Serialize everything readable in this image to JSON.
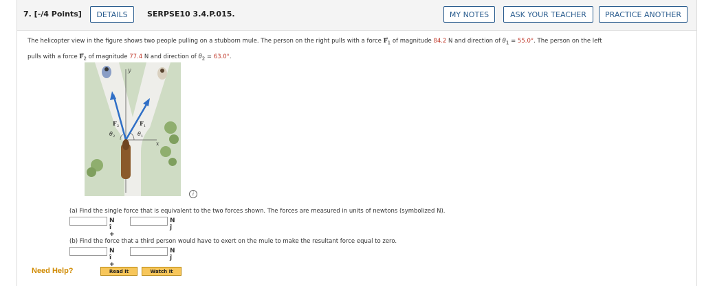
{
  "header": {
    "question_label": "7.  [-/4 Points]",
    "details_label": "DETAILS",
    "problem_code": "SERPSE10 3.4.P.015.",
    "my_notes_label": "MY NOTES",
    "ask_teacher_label": "ASK YOUR TEACHER",
    "practice_label": "PRACTICE ANOTHER"
  },
  "problem": {
    "text1": "The helicopter view in the figure shows two people pulling on a stubborn mule. The person on the right pulls with a force ",
    "f1": "F",
    "f1_sub": "1",
    "text2": " of magnitude ",
    "f1_mag": "84.2",
    "text3": " N and direction of ",
    "theta1": "θ",
    "theta1_sub": "1",
    "eq1": " = ",
    "theta1_val": "55.0°",
    "text4": ". The person on the left",
    "text5": "pulls with a force ",
    "f2": "F",
    "f2_sub": "2",
    "text6": " of magnitude ",
    "f2_mag": "77.4",
    "text7": " N and direction of ",
    "theta2": "θ",
    "theta2_sub": "2",
    "eq2": " = ",
    "theta2_val": "63.0°",
    "text8": "."
  },
  "figure": {
    "y_label": "y",
    "x_label": "x",
    "f1_label": "F",
    "f1_sub": "1",
    "f2_label": "F",
    "f2_sub": "2",
    "theta1_label": "θ",
    "theta1_sub": "1",
    "theta2_label": "θ",
    "theta2_sub": "2",
    "info_icon": "i"
  },
  "part_a": {
    "question": "(a) Find the single force that is equivalent to the two forces shown. The forces are measured in units of newtons (symbolized N).",
    "unit_i": "N î +",
    "unit_j": "N ĵ",
    "input_i": "",
    "input_j": ""
  },
  "part_b": {
    "question": "(b) Find the force that a third person would have to exert on the mule to make the resultant force equal to zero.",
    "unit_i": "N î +",
    "unit_j": "N ĵ",
    "input_i": "",
    "input_j": ""
  },
  "help": {
    "label": "Need Help?",
    "read_it": "Read It",
    "watch_it": "Watch It"
  },
  "colors": {
    "button_border": "#2b5d8f",
    "highlight_value": "#c0392b",
    "help_label": "#d08a00",
    "help_button": "#f7c65a",
    "force_arrow": "#2f6fc6"
  }
}
